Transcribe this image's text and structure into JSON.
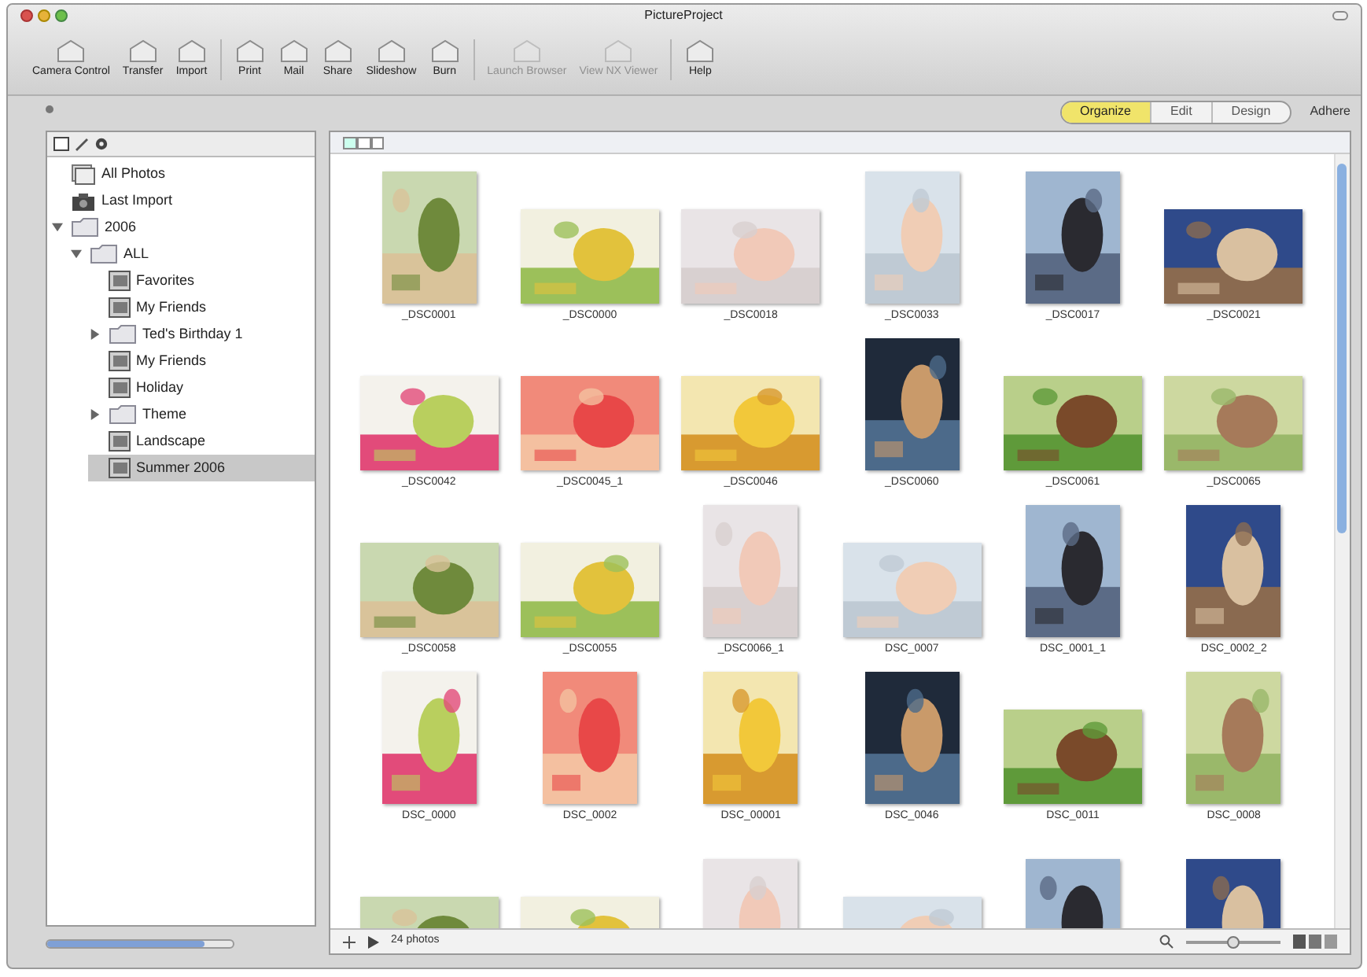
{
  "window": {
    "title": "PictureProject"
  },
  "toolbar": [
    {
      "label": "Camera Control",
      "disabled": false
    },
    {
      "label": "Transfer",
      "disabled": false
    },
    {
      "label": "Import",
      "disabled": false
    },
    {
      "label": "Print",
      "disabled": false
    },
    {
      "label": "Mail",
      "disabled": false
    },
    {
      "label": "Share",
      "disabled": false
    },
    {
      "label": "Slideshow",
      "disabled": false
    },
    {
      "label": "Burn",
      "disabled": false
    },
    {
      "label": "Launch Browser",
      "disabled": true
    },
    {
      "label": "View NX Viewer",
      "disabled": true
    },
    {
      "label": "Help",
      "disabled": false
    }
  ],
  "mode_tabs": [
    {
      "label": "Organize",
      "selected": true
    },
    {
      "label": "Edit",
      "selected": false
    },
    {
      "label": "Design",
      "selected": false
    }
  ],
  "panel_title": "Adhere",
  "sidebar": {
    "items": [
      {
        "label": "All Photos",
        "kind": "photos",
        "selected": false
      },
      {
        "label": "Last Import",
        "kind": "import",
        "selected": false
      },
      {
        "label": "2006",
        "kind": "folder",
        "expanded": true,
        "children": [
          {
            "label": "ALL",
            "kind": "folder",
            "expanded": true,
            "children": [
              {
                "label": "Favorites",
                "kind": "album",
                "selected": false
              },
              {
                "label": "My Friends",
                "kind": "album",
                "selected": false
              },
              {
                "label": "Ted's Birthday 1",
                "kind": "folder",
                "expanded": false
              },
              {
                "label": "My Friends",
                "kind": "album",
                "selected": false
              },
              {
                "label": "Holiday",
                "kind": "album",
                "selected": false
              },
              {
                "label": "Theme",
                "kind": "folder",
                "expanded": false
              },
              {
                "label": "Landscape",
                "kind": "album",
                "selected": false
              },
              {
                "label": "Summer 2006",
                "kind": "album",
                "selected": true
              }
            ]
          }
        ]
      }
    ],
    "size_slider": {
      "level": 0.85
    }
  },
  "photos": [
    {
      "caption": "_DSC0001",
      "kind": "portrait"
    },
    {
      "caption": "_DSC0000",
      "kind": "landscape"
    },
    {
      "caption": "_DSC0018",
      "kind": "landscape"
    },
    {
      "caption": "_DSC0033",
      "kind": "portrait"
    },
    {
      "caption": "_DSC0017",
      "kind": "portrait"
    },
    {
      "caption": "_DSC0021",
      "kind": "landscape"
    },
    {
      "caption": "_DSC0042",
      "kind": "landscape"
    },
    {
      "caption": "_DSC0045_1",
      "kind": "landscape"
    },
    {
      "caption": "_DSC0046",
      "kind": "landscape"
    },
    {
      "caption": "_DSC0060",
      "kind": "portrait"
    },
    {
      "caption": "_DSC0061",
      "kind": "landscape"
    },
    {
      "caption": "_DSC0065",
      "kind": "landscape"
    },
    {
      "caption": "_DSC0058",
      "kind": "landscape"
    },
    {
      "caption": "_DSC0055",
      "kind": "landscape"
    },
    {
      "caption": "_DSC0066_1",
      "kind": "portrait"
    },
    {
      "caption": "DSC_0007",
      "kind": "landscape"
    },
    {
      "caption": "DSC_0001_1",
      "kind": "portrait"
    },
    {
      "caption": "DSC_0002_2",
      "kind": "portrait"
    },
    {
      "caption": "DSC_0000",
      "kind": "portrait"
    },
    {
      "caption": "DSC_0002",
      "kind": "portrait"
    },
    {
      "caption": "DSC_00001",
      "kind": "portrait"
    },
    {
      "caption": "DSC_0046",
      "kind": "portrait"
    },
    {
      "caption": "DSC_0011",
      "kind": "landscape"
    },
    {
      "caption": "DSC_0008",
      "kind": "portrait"
    },
    {
      "kind": "landscape"
    },
    {
      "kind": "landscape"
    },
    {
      "kind": "portrait"
    },
    {
      "kind": "landscape"
    },
    {
      "kind": "portrait"
    },
    {
      "kind": "portrait"
    }
  ],
  "status_bar": {
    "count": "24 photos",
    "zoom_slider": {
      "level": 0.5
    }
  }
}
